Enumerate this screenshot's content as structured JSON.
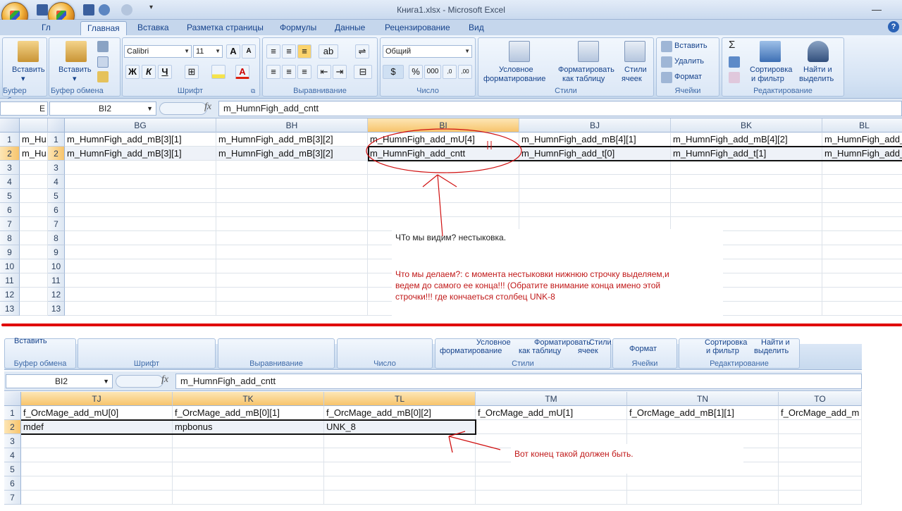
{
  "window": {
    "title": "Книга1.xlsx - Microsoft Excel"
  },
  "tabs": [
    {
      "label": "Главная"
    },
    {
      "label": "Вставка"
    },
    {
      "label": "Разметка страницы"
    },
    {
      "label": "Формулы"
    },
    {
      "label": "Данные"
    },
    {
      "label": "Рецензирование"
    },
    {
      "label": "Вид"
    }
  ],
  "tab_fragment": "Гл",
  "ribbon": {
    "groups": {
      "clipboard": "Буфер обмена",
      "clipboard_cut": "Буфер обме",
      "font": "Шрифт",
      "alignment": "Выравнивание",
      "number": "Число",
      "styles": "Стили",
      "cells": "Ячейки",
      "editing": "Редактирование"
    },
    "paste": "Вставить",
    "font_name": "Calibri",
    "font_size": "11",
    "bold": "Ж",
    "italic": "К",
    "underline": "Ч",
    "number_format": "Общий",
    "percent": "%",
    "thousands": "000",
    "dec_inc": ",0 ,00",
    "dec_dec": ",00 ,0",
    "conditional_1": "Условное",
    "conditional_2": "форматирование",
    "format_table_1": "Форматировать",
    "format_table_2": "как таблицу",
    "cell_styles_1": "Стили",
    "cell_styles_2": "ячеек",
    "insert_cells": "Вставить",
    "delete_cells": "Удалить",
    "format_cells": "Формат",
    "sort_1": "Сортировка",
    "sort_2": "и фильтр",
    "find_1": "Найти и",
    "find_2": "выделить",
    "sigma": "Σ"
  },
  "top": {
    "name_box": "BI2",
    "name_box_cut": "E",
    "formula": "m_HumnFigh_add_cntt",
    "fx": "fx",
    "columns": [
      "BG",
      "BH",
      "BI",
      "BJ",
      "BK",
      "BL"
    ],
    "left_col_prefix": "m_Hu",
    "rows": [
      "1",
      "2",
      "3",
      "4",
      "5",
      "6",
      "7",
      "8",
      "9",
      "10",
      "11",
      "12",
      "13"
    ],
    "row1": [
      "m_HumnFigh_add_mB[3][1]",
      "m_HumnFigh_add_mB[3][2]",
      "m_HumnFigh_add_mU[4]",
      "m_HumnFigh_add_mB[4][1]",
      "m_HumnFigh_add_mB[4][2]",
      "m_HumnFigh_add_"
    ],
    "row2": [
      "m_HumnFigh_add_mB[3][1]",
      "m_HumnFigh_add_mB[3][2]",
      "m_HumnFigh_add_cntt",
      "m_HumnFigh_add_t[0]",
      "m_HumnFigh_add_t[1]",
      "m_HumnFigh_add_"
    ],
    "left_row1": "m_Hu",
    "left_row2": "m_Hu"
  },
  "annotation": {
    "line1": "ЧТо мы видим? нестыковка.",
    "line2": "Что мы делаем?: с момента нестыковки нижнюю строчку выделяем,и",
    "line3": "ведем до самого ее конца!!! (Обратите внимание конца имено этой",
    "line4": "строчки!!! где кончаеться столбец UNK-8",
    "bottom_note": "Вот конец такой должен быть."
  },
  "bottom": {
    "name_box": "BI2",
    "formula": "m_HumnFigh_add_cntt",
    "fx": "fx",
    "columns": [
      "TJ",
      "TK",
      "TL",
      "TM",
      "TN",
      "TO"
    ],
    "rows": [
      "1",
      "2",
      "3",
      "4",
      "5",
      "6",
      "7"
    ],
    "row1": [
      "f_OrcMage_add_mU[0]",
      "f_OrcMage_add_mB[0][1]",
      "f_OrcMage_add_mB[0][2]",
      "f_OrcMage_add_mU[1]",
      "f_OrcMage_add_mB[1][1]",
      "f_OrcMage_add_m"
    ],
    "row2": [
      "mdef",
      "mpbonus",
      "UNK_8",
      "",
      "",
      ""
    ],
    "ribbon_groups": [
      "Буфер обмена",
      "Шрифт",
      "Выравнивание",
      "Число",
      "Стили",
      "Ячейки",
      "Редактирование"
    ],
    "ribbon_top": [
      "Вставить",
      "Условное",
      "форматирование",
      "Форматировать",
      "как таблицу",
      "Стили",
      "ячеек",
      "Формат",
      "Сортировка",
      "и фильтр",
      "Найти и",
      "выделить"
    ]
  },
  "colors": {
    "accent": "#15428b",
    "annotation_red": "#c01818",
    "selection": "#f7c46c"
  }
}
